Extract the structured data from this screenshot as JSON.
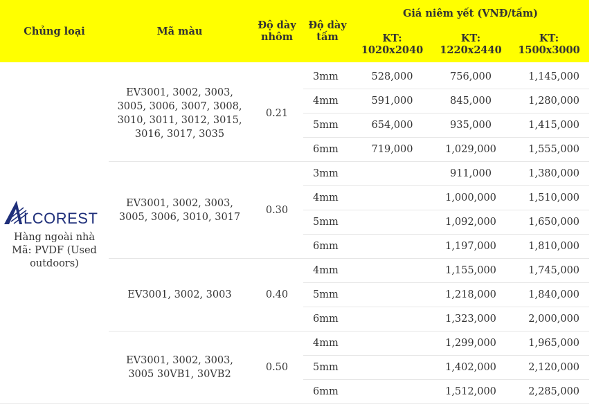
{
  "header": {
    "type": "Chủng loại",
    "color_code": "Mã màu",
    "alu_thickness": "Độ dày nhôm",
    "panel_thickness": "Độ dày tấm",
    "price_group": "Giá niêm yết (VNĐ/tấm)",
    "size1": "KT: 1020x2040",
    "size2": "KT: 1220x2440",
    "size3": "KT: 1500x3000"
  },
  "brand": {
    "logo_text": "LCOREST",
    "logo_letter": "A",
    "line1": "Hàng ngoài nhà",
    "line2": "Mã: PVDF (Used",
    "line3": "outdoors)",
    "logo_color": "#1f2f7a"
  },
  "groups": [
    {
      "colors": "EV3001, 3002, 3003, 3005, 3006, 3007, 3008, 3010, 3011, 3012, 3015, 3016, 3017, 3035",
      "alu": "0.21",
      "rows": [
        {
          "t": "3mm",
          "p1": "528,000",
          "p2": "756,000",
          "p3": "1,145,000"
        },
        {
          "t": "4mm",
          "p1": "591,000",
          "p2": "845,000",
          "p3": "1,280,000"
        },
        {
          "t": "5mm",
          "p1": "654,000",
          "p2": "935,000",
          "p3": "1,415,000"
        },
        {
          "t": "6mm",
          "p1": "719,000",
          "p2": "1,029,000",
          "p3": "1,555,000"
        }
      ]
    },
    {
      "colors": "EV3001, 3002, 3003, 3005, 3006, 3010, 3017",
      "alu": "0.30",
      "rows": [
        {
          "t": "3mm",
          "p1": "",
          "p2": "911,000",
          "p3": "1,380,000"
        },
        {
          "t": "4mm",
          "p1": "",
          "p2": "1,000,000",
          "p3": "1,510,000"
        },
        {
          "t": "5mm",
          "p1": "",
          "p2": "1,092,000",
          "p3": "1,650,000"
        },
        {
          "t": "6mm",
          "p1": "",
          "p2": "1,197,000",
          "p3": "1,810,000"
        }
      ]
    },
    {
      "colors": "EV3001, 3002, 3003",
      "alu": "0.40",
      "rows": [
        {
          "t": "4mm",
          "p1": "",
          "p2": "1,155,000",
          "p3": "1,745,000"
        },
        {
          "t": "5mm",
          "p1": "",
          "p2": "1,218,000",
          "p3": "1,840,000"
        },
        {
          "t": "6mm",
          "p1": "",
          "p2": "1,323,000",
          "p3": "2,000,000"
        }
      ]
    },
    {
      "colors": "EV3001, 3002, 3003, 3005 30VB1, 30VB2",
      "alu": "0.50",
      "rows": [
        {
          "t": "4mm",
          "p1": "",
          "p2": "1,299,000",
          "p3": "1,965,000"
        },
        {
          "t": "5mm",
          "p1": "",
          "p2": "1,402,000",
          "p3": "2,120,000"
        },
        {
          "t": "6mm",
          "p1": "",
          "p2": "1,512,000",
          "p3": "2,285,000"
        }
      ]
    }
  ]
}
